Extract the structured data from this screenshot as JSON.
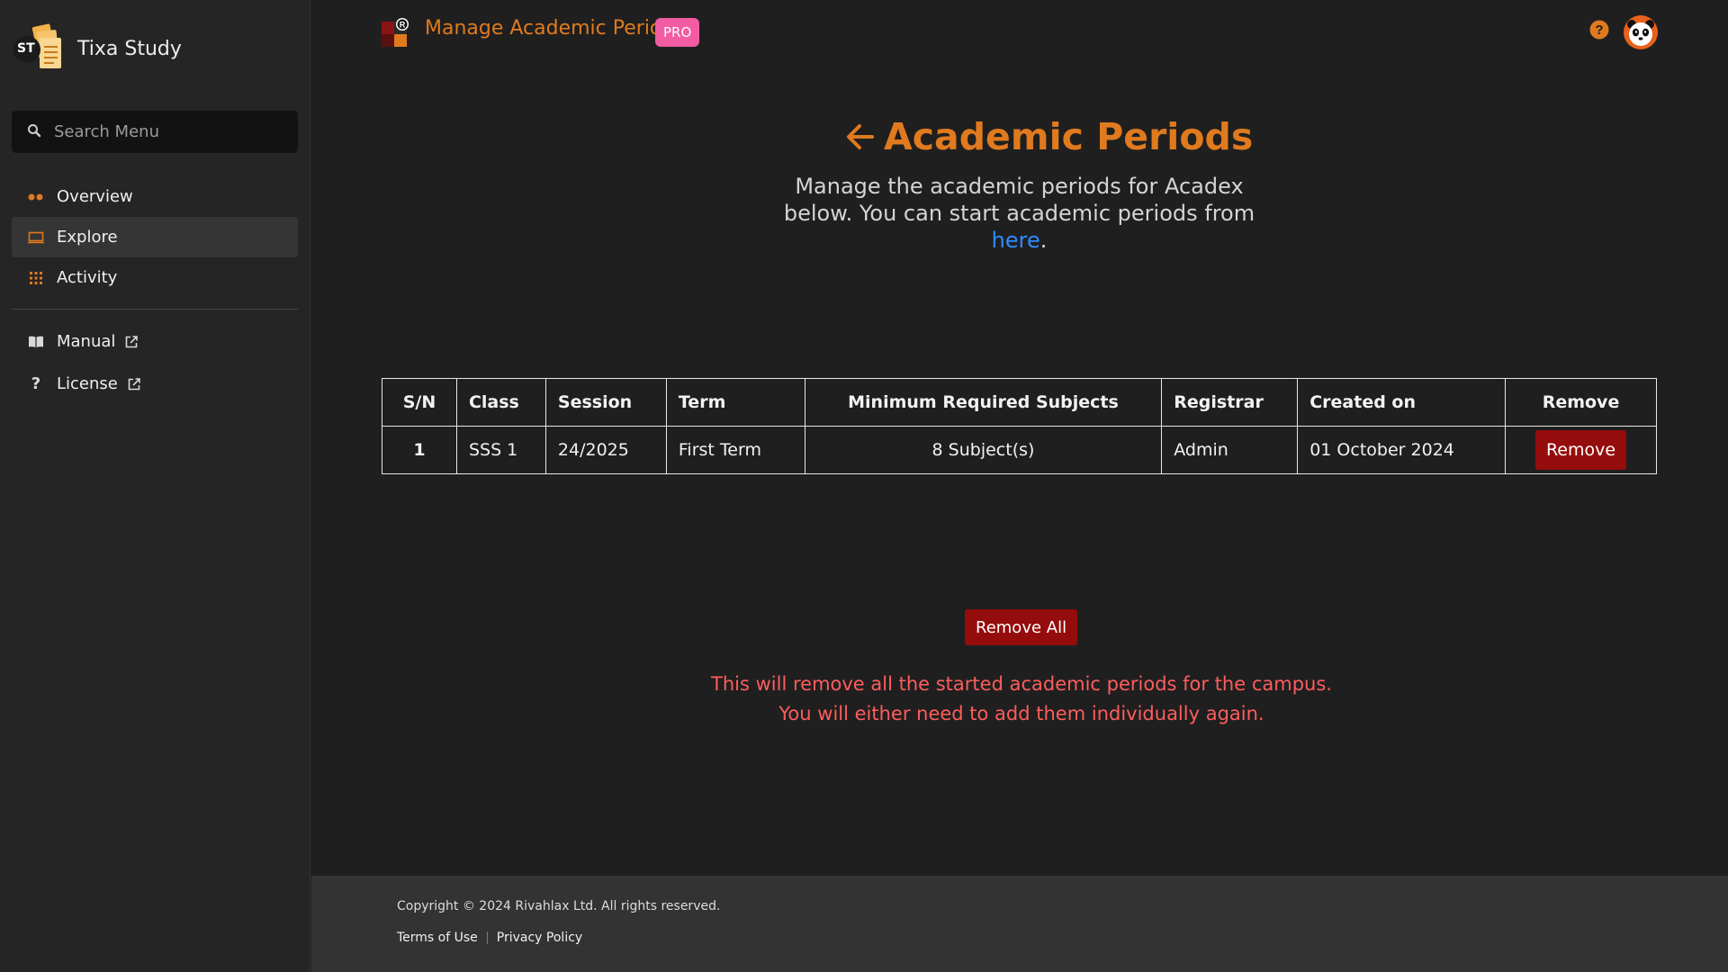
{
  "brand": {
    "name": "Tixa Study",
    "logo_initials": "ST"
  },
  "search": {
    "placeholder": "Search Menu"
  },
  "nav": {
    "items": [
      {
        "label": "Overview",
        "icon": "dots-icon"
      },
      {
        "label": "Explore",
        "icon": "monitor-icon"
      },
      {
        "label": "Activity",
        "icon": "grid-icon"
      }
    ],
    "secondary": [
      {
        "label": "Manual",
        "icon": "book-icon"
      },
      {
        "label": "License",
        "icon": "question-icon"
      }
    ]
  },
  "header": {
    "title": "Manage Academic Period",
    "badge": "PRO"
  },
  "page": {
    "title": "Academic Periods",
    "intro_text": "Manage the academic periods for Acadex below. You can start academic periods from ",
    "intro_link": "here",
    "intro_end": "."
  },
  "table": {
    "headers": [
      "S/N",
      "Class",
      "Session",
      "Term",
      "Minimum Required Subjects",
      "Registrar",
      "Created on",
      "Remove"
    ],
    "rows": [
      {
        "sn": "1",
        "class": "SSS 1",
        "session": "24/2025",
        "term": "First Term",
        "min_subjects": "8 Subject(s)",
        "registrar": "Admin",
        "created_on": "01 October 2024",
        "remove_label": "Remove"
      }
    ]
  },
  "actions": {
    "remove_all": "Remove All",
    "warning_line1": "This will remove all the started academic periods for the campus.",
    "warning_line2": "You will either need to add them individually again."
  },
  "footer": {
    "copyright": "Copyright © 2024 Rivahlax Ltd. All rights reserved.",
    "terms": "Terms of Use",
    "privacy": "Privacy Policy"
  },
  "colors": {
    "accent": "#e07a1e",
    "danger": "#950c0c",
    "warning_text": "#ff5d5d",
    "badge": "#f25ca2",
    "link": "#2e8bff"
  }
}
